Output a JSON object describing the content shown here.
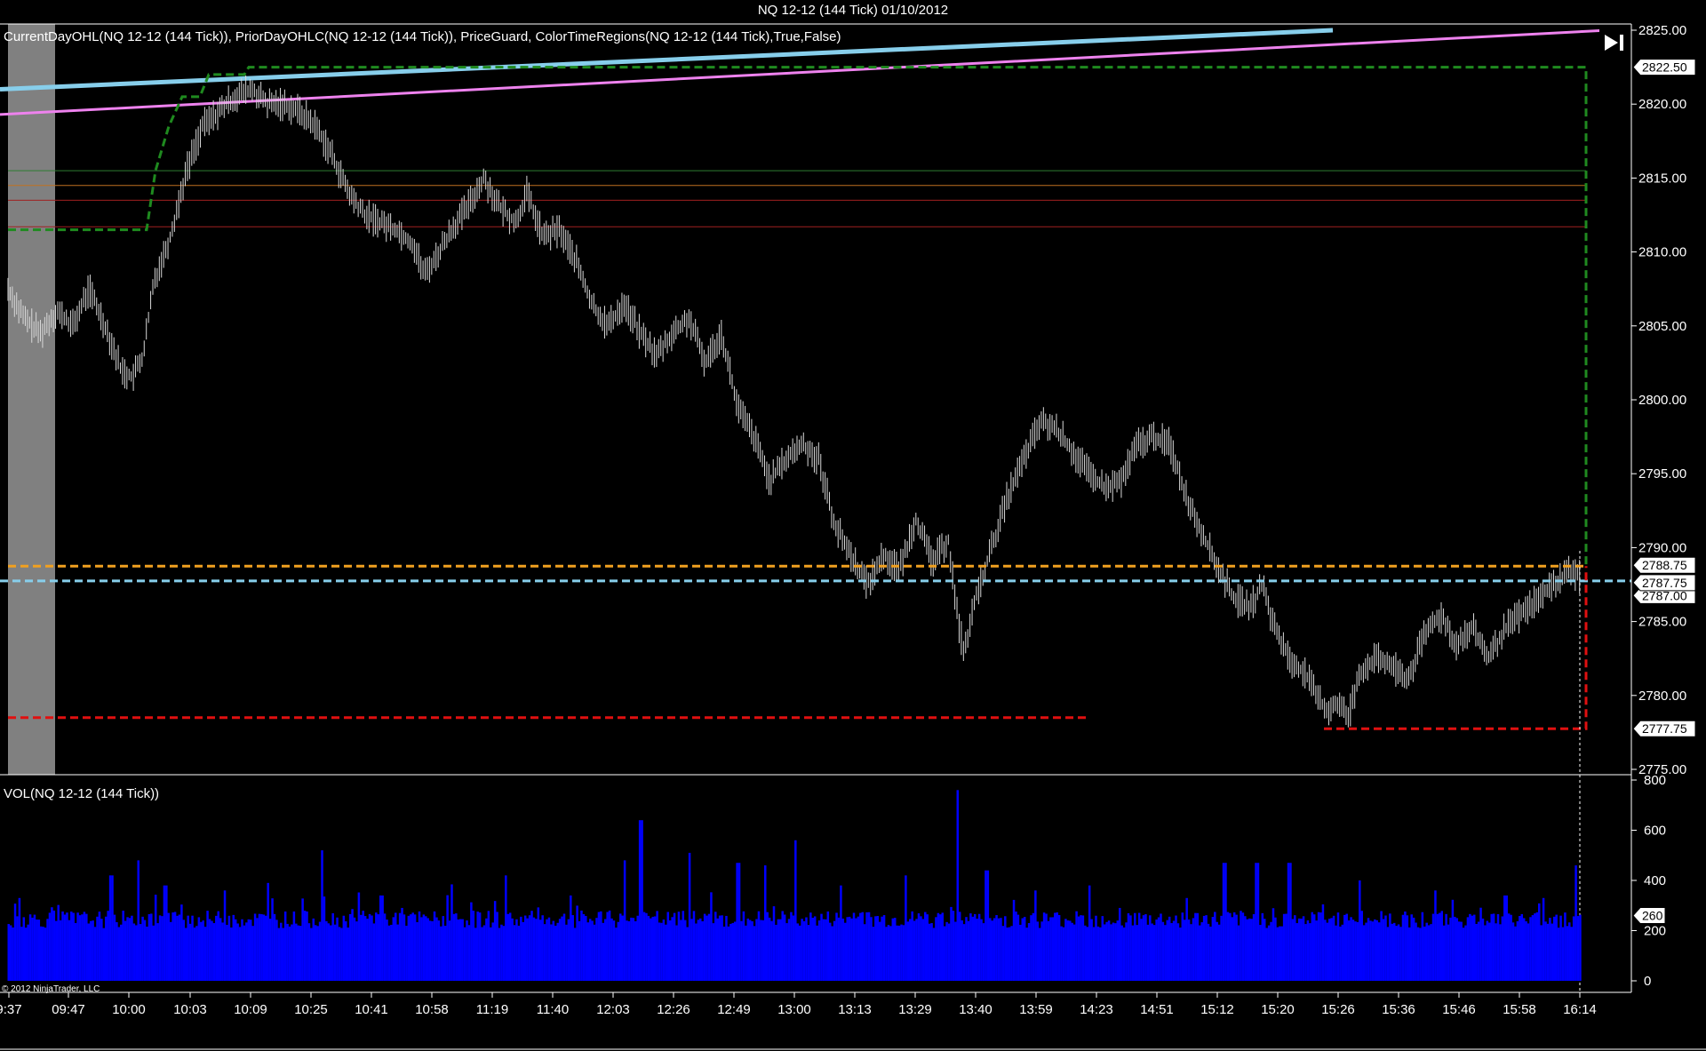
{
  "window": {
    "title": "NQ 12-12 (144 Tick)  01/10/2012"
  },
  "price_panel": {
    "indicators_label": "CurrentDayOHL(NQ 12-12 (144 Tick)),  PriorDayOHLC(NQ 12-12 (144 Tick)),  PriceGuard,  ColorTimeRegions(NQ 12-12 (144 Tick),True,False)",
    "markers": [
      "2822.50",
      "2788.75",
      "2787.75",
      "2787.00",
      "2777.75"
    ]
  },
  "volume_panel": {
    "label": "VOL(NQ 12-12 (144 Tick))",
    "marker": "260"
  },
  "copyright": "© 2012 NinjaTrader, LLC",
  "colors": {
    "background": "#000000",
    "bars": "#d9d9d9",
    "volume": "#0000ff",
    "high_dash": "#1f8a1f",
    "low_dash": "#e01010",
    "open_dash": "#f0a020",
    "close_dash": "#87ceeb",
    "trend_blue": "#87ceeb",
    "trend_pink": "#ee82ee",
    "time_region": "#808080"
  },
  "chart_data": [
    {
      "type": "ohlc",
      "title": "NQ 12-12 (144 Tick)  01/10/2012",
      "x_tick_labels": [
        "9:37",
        "09:47",
        "10:00",
        "10:03",
        "10:09",
        "10:25",
        "10:41",
        "10:58",
        "11:19",
        "11:40",
        "12:03",
        "12:26",
        "12:49",
        "13:00",
        "13:13",
        "13:29",
        "13:40",
        "13:59",
        "14:23",
        "14:51",
        "15:12",
        "15:20",
        "15:26",
        "15:36",
        "15:46",
        "15:58",
        "16:14"
      ],
      "y_tick_labels": [
        "2825.00",
        "2820.00",
        "2815.00",
        "2810.00",
        "2805.00",
        "2800.00",
        "2795.00",
        "2790.00",
        "2785.00",
        "2780.00",
        "2775.00"
      ],
      "ylim": [
        2775,
        2825
      ],
      "grid": false,
      "close_path": [
        {
          "x": 0,
          "y": 2807.5
        },
        {
          "x": 15,
          "y": 2805.5
        },
        {
          "x": 30,
          "y": 2804.5
        },
        {
          "x": 45,
          "y": 2806.0
        },
        {
          "x": 60,
          "y": 2805.0
        },
        {
          "x": 75,
          "y": 2807.5
        },
        {
          "x": 90,
          "y": 2805.0
        },
        {
          "x": 105,
          "y": 2802.0
        },
        {
          "x": 115,
          "y": 2801.5
        },
        {
          "x": 125,
          "y": 2803.0
        },
        {
          "x": 135,
          "y": 2808.0
        },
        {
          "x": 150,
          "y": 2811.0
        },
        {
          "x": 165,
          "y": 2815.5
        },
        {
          "x": 180,
          "y": 2818.5
        },
        {
          "x": 195,
          "y": 2819.5
        },
        {
          "x": 210,
          "y": 2820.5
        },
        {
          "x": 225,
          "y": 2821.0
        },
        {
          "x": 240,
          "y": 2820.0
        },
        {
          "x": 255,
          "y": 2820.0
        },
        {
          "x": 270,
          "y": 2819.5
        },
        {
          "x": 285,
          "y": 2818.5
        },
        {
          "x": 300,
          "y": 2816.5
        },
        {
          "x": 315,
          "y": 2814.0
        },
        {
          "x": 330,
          "y": 2812.5
        },
        {
          "x": 345,
          "y": 2812.0
        },
        {
          "x": 360,
          "y": 2811.5
        },
        {
          "x": 375,
          "y": 2810.5
        },
        {
          "x": 385,
          "y": 2808.5
        },
        {
          "x": 395,
          "y": 2809.5
        },
        {
          "x": 410,
          "y": 2811.5
        },
        {
          "x": 425,
          "y": 2813.0
        },
        {
          "x": 440,
          "y": 2815.0
        },
        {
          "x": 455,
          "y": 2813.0
        },
        {
          "x": 470,
          "y": 2812.0
        },
        {
          "x": 480,
          "y": 2814.0
        },
        {
          "x": 495,
          "y": 2811.0
        },
        {
          "x": 510,
          "y": 2811.5
        },
        {
          "x": 525,
          "y": 2809.5
        },
        {
          "x": 540,
          "y": 2806.5
        },
        {
          "x": 555,
          "y": 2805.0
        },
        {
          "x": 570,
          "y": 2806.5
        },
        {
          "x": 585,
          "y": 2804.5
        },
        {
          "x": 600,
          "y": 2803.0
        },
        {
          "x": 615,
          "y": 2804.5
        },
        {
          "x": 630,
          "y": 2805.5
        },
        {
          "x": 645,
          "y": 2802.5
        },
        {
          "x": 660,
          "y": 2804.5
        },
        {
          "x": 675,
          "y": 2799.5
        },
        {
          "x": 690,
          "y": 2797.5
        },
        {
          "x": 705,
          "y": 2794.5
        },
        {
          "x": 720,
          "y": 2796.0
        },
        {
          "x": 735,
          "y": 2797.0
        },
        {
          "x": 750,
          "y": 2796.0
        },
        {
          "x": 765,
          "y": 2791.5
        },
        {
          "x": 780,
          "y": 2789.5
        },
        {
          "x": 795,
          "y": 2787.5
        },
        {
          "x": 810,
          "y": 2789.5
        },
        {
          "x": 825,
          "y": 2788.5
        },
        {
          "x": 840,
          "y": 2792.0
        },
        {
          "x": 855,
          "y": 2789.0
        },
        {
          "x": 870,
          "y": 2790.5
        },
        {
          "x": 880,
          "y": 2784.5
        },
        {
          "x": 885,
          "y": 2783.0
        },
        {
          "x": 895,
          "y": 2786.5
        },
        {
          "x": 910,
          "y": 2790.0
        },
        {
          "x": 925,
          "y": 2793.5
        },
        {
          "x": 940,
          "y": 2796.0
        },
        {
          "x": 955,
          "y": 2798.5
        },
        {
          "x": 970,
          "y": 2798.0
        },
        {
          "x": 985,
          "y": 2796.5
        },
        {
          "x": 1000,
          "y": 2795.0
        },
        {
          "x": 1015,
          "y": 2794.0
        },
        {
          "x": 1030,
          "y": 2794.5
        },
        {
          "x": 1045,
          "y": 2797.0
        },
        {
          "x": 1060,
          "y": 2797.5
        },
        {
          "x": 1075,
          "y": 2797.0
        },
        {
          "x": 1090,
          "y": 2793.5
        },
        {
          "x": 1105,
          "y": 2791.0
        },
        {
          "x": 1120,
          "y": 2788.5
        },
        {
          "x": 1135,
          "y": 2786.5
        },
        {
          "x": 1150,
          "y": 2786.0
        },
        {
          "x": 1160,
          "y": 2787.5
        },
        {
          "x": 1170,
          "y": 2785.0
        },
        {
          "x": 1185,
          "y": 2782.5
        },
        {
          "x": 1200,
          "y": 2781.5
        },
        {
          "x": 1210,
          "y": 2780.0
        },
        {
          "x": 1220,
          "y": 2779.0
        },
        {
          "x": 1230,
          "y": 2779.5
        },
        {
          "x": 1240,
          "y": 2778.5
        },
        {
          "x": 1250,
          "y": 2781.5
        },
        {
          "x": 1265,
          "y": 2782.5
        },
        {
          "x": 1280,
          "y": 2782.0
        },
        {
          "x": 1295,
          "y": 2781.0
        },
        {
          "x": 1310,
          "y": 2784.0
        },
        {
          "x": 1325,
          "y": 2785.5
        },
        {
          "x": 1340,
          "y": 2783.5
        },
        {
          "x": 1355,
          "y": 2784.5
        },
        {
          "x": 1370,
          "y": 2782.5
        },
        {
          "x": 1385,
          "y": 2784.5
        },
        {
          "x": 1400,
          "y": 2785.5
        },
        {
          "x": 1415,
          "y": 2786.5
        },
        {
          "x": 1430,
          "y": 2787.5
        },
        {
          "x": 1445,
          "y": 2788.5
        },
        {
          "x": 1455,
          "y": 2788.0
        }
      ],
      "levels": [
        {
          "kind": "current_high",
          "value": 2822.5,
          "style": "dashed"
        },
        {
          "kind": "prior_high",
          "value": 2811.5,
          "style": "dashed"
        },
        {
          "kind": "open",
          "value": 2788.75,
          "style": "dashed"
        },
        {
          "kind": "close",
          "value": 2787.75,
          "style": "dashed"
        },
        {
          "kind": "current_low",
          "value": 2777.75,
          "style": "dashed"
        },
        {
          "kind": "prior_low",
          "value": 2778.5,
          "style": "dashed"
        },
        {
          "kind": "thin",
          "value": 2815.5
        },
        {
          "kind": "thin",
          "value": 2814.5
        },
        {
          "kind": "thin",
          "value": 2813.5
        },
        {
          "kind": "thin",
          "value": 2811.7
        }
      ],
      "trendlines": [
        {
          "name": "blue",
          "y_start": 2821.0,
          "y_end": 2825.0
        },
        {
          "name": "pink",
          "y_start": 2819.3,
          "y_end": 2825.0
        }
      ]
    },
    {
      "type": "bar",
      "title": "VOL(NQ 12-12 (144 Tick))",
      "y_tick_labels": [
        "800",
        "600",
        "400",
        "200",
        "0"
      ],
      "ylim": [
        0,
        800
      ],
      "last_value": 260,
      "base_level": 240,
      "spikes": [
        {
          "x": 10,
          "value": 330
        },
        {
          "x": 95,
          "value": 420
        },
        {
          "x": 120,
          "value": 480
        },
        {
          "x": 145,
          "value": 380
        },
        {
          "x": 200,
          "value": 360
        },
        {
          "x": 240,
          "value": 390
        },
        {
          "x": 290,
          "value": 520
        },
        {
          "x": 345,
          "value": 340
        },
        {
          "x": 410,
          "value": 380
        },
        {
          "x": 460,
          "value": 420
        },
        {
          "x": 520,
          "value": 340
        },
        {
          "x": 570,
          "value": 480
        },
        {
          "x": 585,
          "value": 640
        },
        {
          "x": 630,
          "value": 510
        },
        {
          "x": 675,
          "value": 470
        },
        {
          "x": 700,
          "value": 460
        },
        {
          "x": 728,
          "value": 560
        },
        {
          "x": 770,
          "value": 380
        },
        {
          "x": 830,
          "value": 420
        },
        {
          "x": 878,
          "value": 760
        },
        {
          "x": 905,
          "value": 440
        },
        {
          "x": 950,
          "value": 360
        },
        {
          "x": 1000,
          "value": 380
        },
        {
          "x": 1090,
          "value": 330
        },
        {
          "x": 1125,
          "value": 470
        },
        {
          "x": 1155,
          "value": 470
        },
        {
          "x": 1185,
          "value": 470
        },
        {
          "x": 1250,
          "value": 400
        },
        {
          "x": 1320,
          "value": 360
        },
        {
          "x": 1385,
          "value": 340
        },
        {
          "x": 1420,
          "value": 330
        },
        {
          "x": 1450,
          "value": 460
        }
      ]
    }
  ]
}
